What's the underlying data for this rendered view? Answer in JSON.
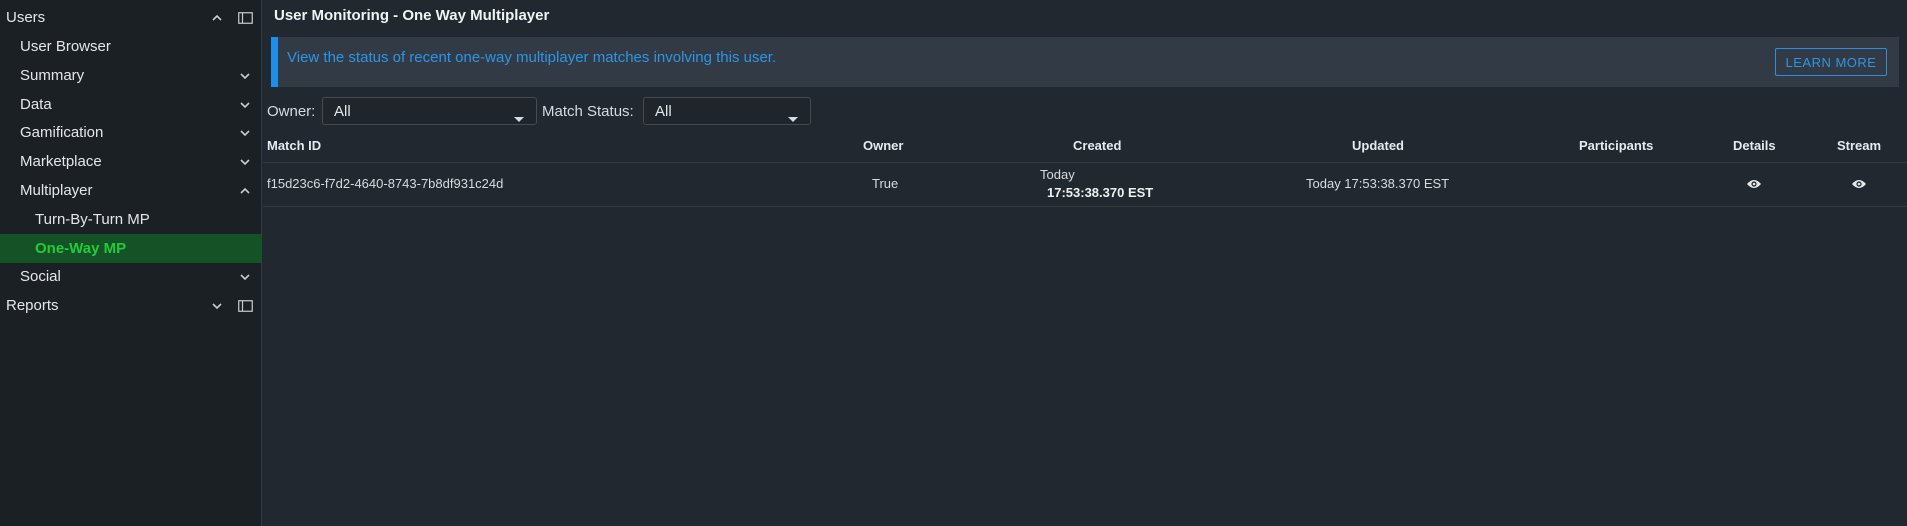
{
  "sidebar": {
    "users": "Users",
    "user_browser": "User Browser",
    "summary": "Summary",
    "data": "Data",
    "gamification": "Gamification",
    "marketplace": "Marketplace",
    "multiplayer": "Multiplayer",
    "turn_by_turn": "Turn-By-Turn MP",
    "one_way": "One-Way MP",
    "social": "Social",
    "reports": "Reports"
  },
  "header": {
    "title": "User Monitoring - One Way Multiplayer"
  },
  "banner": {
    "text": "View the status of recent one-way multiplayer matches involving this user.",
    "button": "LEARN MORE"
  },
  "filters": {
    "owner_label": "Owner:",
    "owner_value": "All",
    "status_label": "Match Status:",
    "status_value": "All"
  },
  "table": {
    "columns": [
      "Match ID",
      "Owner",
      "Created",
      "Updated",
      "Participants",
      "Details",
      "Stream"
    ],
    "rows": [
      {
        "match_id": "f15d23c6-f7d2-4640-8743-7b8df931c24d",
        "owner": "True",
        "created_day": "Today",
        "created_time": "17:53:38.370 EST",
        "updated": "Today 17:53:38.370 EST",
        "participants": ""
      }
    ]
  },
  "colors": {
    "accent_blue": "#2b95e6",
    "active_green": "#1fcc3e",
    "active_bg": "#155326"
  }
}
